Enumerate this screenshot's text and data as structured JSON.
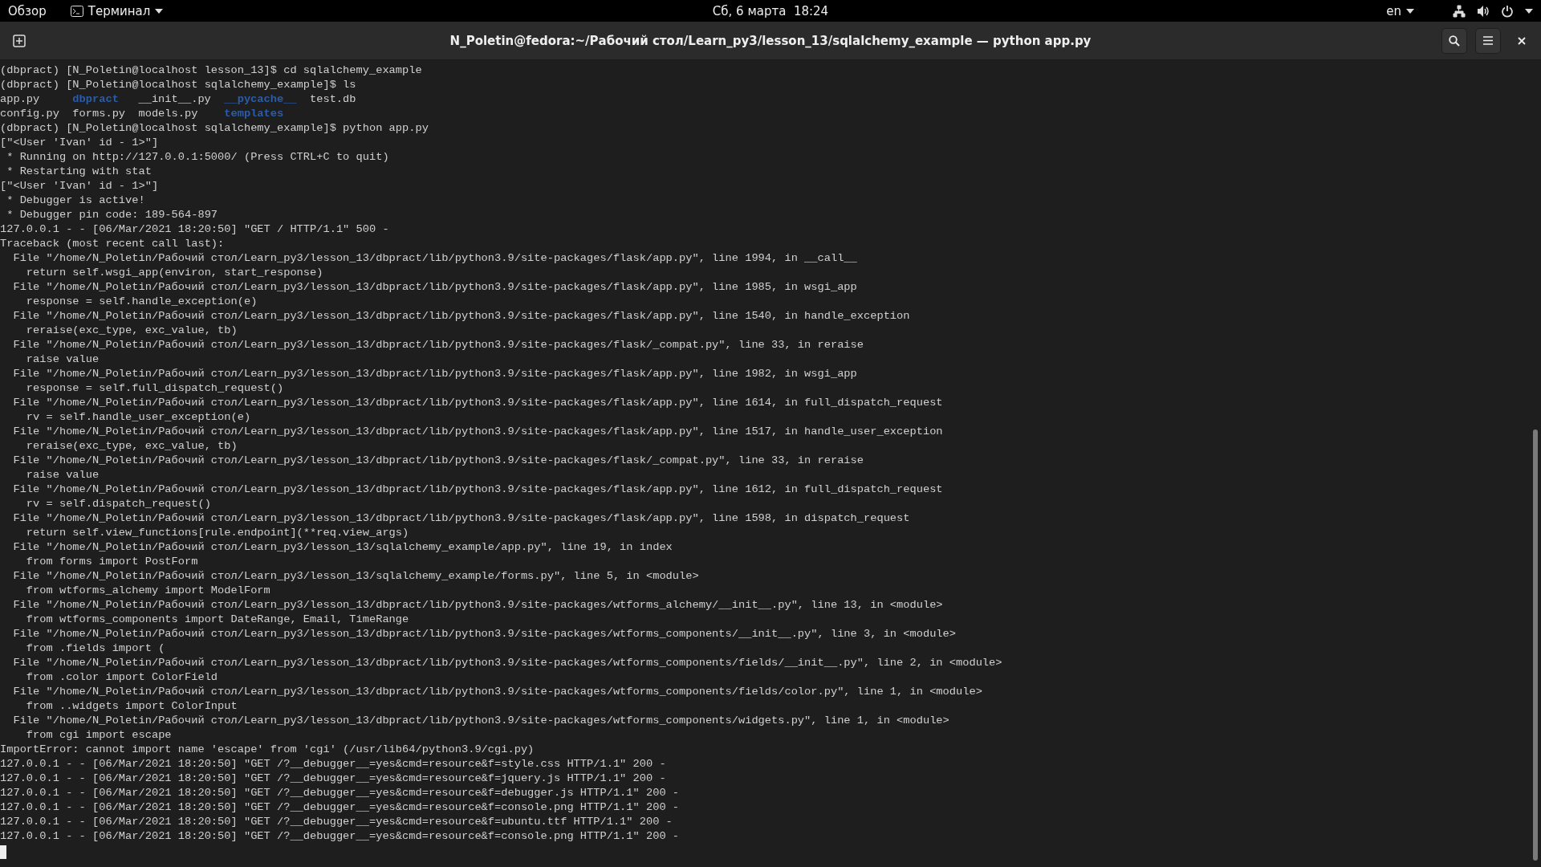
{
  "top_bar": {
    "activities": "Обзор",
    "app_menu": "Терминал",
    "clock": "Сб, 6 марта  18:24",
    "keyboard_layout": "en"
  },
  "window": {
    "title": "N_Poletin@fedora:~/Рабочий стол/Learn_py3/lesson_13/sqlalchemy_example — python app.py"
  },
  "terminal": {
    "lines": [
      {
        "kind": "text",
        "text": "(dbpract) [N_Poletin@localhost lesson_13]$ cd sqlalchemy_example"
      },
      {
        "kind": "text",
        "text": "(dbpract) [N_Poletin@localhost sqlalchemy_example]$ ls"
      },
      {
        "kind": "listing",
        "entries": [
          {
            "name": "app.py",
            "kind": "file"
          },
          {
            "name": "dbpract",
            "kind": "dir"
          },
          {
            "name": "__init__.py",
            "kind": "file"
          },
          {
            "name": "__pycache__",
            "kind": "dir"
          },
          {
            "name": "test.db",
            "kind": "file"
          }
        ]
      },
      {
        "kind": "listing",
        "entries": [
          {
            "name": "config.py",
            "kind": "file"
          },
          {
            "name": "forms.py",
            "kind": "file"
          },
          {
            "name": "models.py",
            "kind": "file"
          },
          {
            "name": "templates",
            "kind": "dir"
          }
        ]
      },
      {
        "kind": "text",
        "text": "(dbpract) [N_Poletin@localhost sqlalchemy_example]$ python app.py"
      },
      {
        "kind": "text",
        "text": "[\"<User 'Ivan' id - 1>\"]"
      },
      {
        "kind": "text",
        "text": " * Running on http://127.0.0.1:5000/ (Press CTRL+C to quit)"
      },
      {
        "kind": "text",
        "text": " * Restarting with stat"
      },
      {
        "kind": "text",
        "text": "[\"<User 'Ivan' id - 1>\"]"
      },
      {
        "kind": "text",
        "text": " * Debugger is active!"
      },
      {
        "kind": "text",
        "text": " * Debugger pin code: 189-564-897"
      },
      {
        "kind": "text",
        "text": "127.0.0.1 - - [06/Mar/2021 18:20:50] \"GET / HTTP/1.1\" 500 -"
      },
      {
        "kind": "text",
        "text": "Traceback (most recent call last):"
      },
      {
        "kind": "text",
        "text": "  File \"/home/N_Poletin/Рабочий стол/Learn_py3/lesson_13/dbpract/lib/python3.9/site-packages/flask/app.py\", line 1994, in __call__"
      },
      {
        "kind": "text",
        "text": "    return self.wsgi_app(environ, start_response)"
      },
      {
        "kind": "text",
        "text": "  File \"/home/N_Poletin/Рабочий стол/Learn_py3/lesson_13/dbpract/lib/python3.9/site-packages/flask/app.py\", line 1985, in wsgi_app"
      },
      {
        "kind": "text",
        "text": "    response = self.handle_exception(e)"
      },
      {
        "kind": "text",
        "text": "  File \"/home/N_Poletin/Рабочий стол/Learn_py3/lesson_13/dbpract/lib/python3.9/site-packages/flask/app.py\", line 1540, in handle_exception"
      },
      {
        "kind": "text",
        "text": "    reraise(exc_type, exc_value, tb)"
      },
      {
        "kind": "text",
        "text": "  File \"/home/N_Poletin/Рабочий стол/Learn_py3/lesson_13/dbpract/lib/python3.9/site-packages/flask/_compat.py\", line 33, in reraise"
      },
      {
        "kind": "text",
        "text": "    raise value"
      },
      {
        "kind": "text",
        "text": "  File \"/home/N_Poletin/Рабочий стол/Learn_py3/lesson_13/dbpract/lib/python3.9/site-packages/flask/app.py\", line 1982, in wsgi_app"
      },
      {
        "kind": "text",
        "text": "    response = self.full_dispatch_request()"
      },
      {
        "kind": "text",
        "text": "  File \"/home/N_Poletin/Рабочий стол/Learn_py3/lesson_13/dbpract/lib/python3.9/site-packages/flask/app.py\", line 1614, in full_dispatch_request"
      },
      {
        "kind": "text",
        "text": "    rv = self.handle_user_exception(e)"
      },
      {
        "kind": "text",
        "text": "  File \"/home/N_Poletin/Рабочий стол/Learn_py3/lesson_13/dbpract/lib/python3.9/site-packages/flask/app.py\", line 1517, in handle_user_exception"
      },
      {
        "kind": "text",
        "text": "    reraise(exc_type, exc_value, tb)"
      },
      {
        "kind": "text",
        "text": "  File \"/home/N_Poletin/Рабочий стол/Learn_py3/lesson_13/dbpract/lib/python3.9/site-packages/flask/_compat.py\", line 33, in reraise"
      },
      {
        "kind": "text",
        "text": "    raise value"
      },
      {
        "kind": "text",
        "text": "  File \"/home/N_Poletin/Рабочий стол/Learn_py3/lesson_13/dbpract/lib/python3.9/site-packages/flask/app.py\", line 1612, in full_dispatch_request"
      },
      {
        "kind": "text",
        "text": "    rv = self.dispatch_request()"
      },
      {
        "kind": "text",
        "text": "  File \"/home/N_Poletin/Рабочий стол/Learn_py3/lesson_13/dbpract/lib/python3.9/site-packages/flask/app.py\", line 1598, in dispatch_request"
      },
      {
        "kind": "text",
        "text": "    return self.view_functions[rule.endpoint](**req.view_args)"
      },
      {
        "kind": "text",
        "text": "  File \"/home/N_Poletin/Рабочий стол/Learn_py3/lesson_13/sqlalchemy_example/app.py\", line 19, in index"
      },
      {
        "kind": "text",
        "text": "    from forms import PostForm"
      },
      {
        "kind": "text",
        "text": "  File \"/home/N_Poletin/Рабочий стол/Learn_py3/lesson_13/sqlalchemy_example/forms.py\", line 5, in <module>"
      },
      {
        "kind": "text",
        "text": "    from wtforms_alchemy import ModelForm"
      },
      {
        "kind": "text",
        "text": "  File \"/home/N_Poletin/Рабочий стол/Learn_py3/lesson_13/dbpract/lib/python3.9/site-packages/wtforms_alchemy/__init__.py\", line 13, in <module>"
      },
      {
        "kind": "text",
        "text": "    from wtforms_components import DateRange, Email, TimeRange"
      },
      {
        "kind": "text",
        "text": "  File \"/home/N_Poletin/Рабочий стол/Learn_py3/lesson_13/dbpract/lib/python3.9/site-packages/wtforms_components/__init__.py\", line 3, in <module>"
      },
      {
        "kind": "text",
        "text": "    from .fields import ("
      },
      {
        "kind": "text",
        "text": "  File \"/home/N_Poletin/Рабочий стол/Learn_py3/lesson_13/dbpract/lib/python3.9/site-packages/wtforms_components/fields/__init__.py\", line 2, in <module>"
      },
      {
        "kind": "text",
        "text": "    from .color import ColorField"
      },
      {
        "kind": "text",
        "text": "  File \"/home/N_Poletin/Рабочий стол/Learn_py3/lesson_13/dbpract/lib/python3.9/site-packages/wtforms_components/fields/color.py\", line 1, in <module>"
      },
      {
        "kind": "text",
        "text": "    from ..widgets import ColorInput"
      },
      {
        "kind": "text",
        "text": "  File \"/home/N_Poletin/Рабочий стол/Learn_py3/lesson_13/dbpract/lib/python3.9/site-packages/wtforms_components/widgets.py\", line 1, in <module>"
      },
      {
        "kind": "text",
        "text": "    from cgi import escape"
      },
      {
        "kind": "text",
        "text": "ImportError: cannot import name 'escape' from 'cgi' (/usr/lib64/python3.9/cgi.py)"
      },
      {
        "kind": "text",
        "text": "127.0.0.1 - - [06/Mar/2021 18:20:50] \"GET /?__debugger__=yes&cmd=resource&f=style.css HTTP/1.1\" 200 -"
      },
      {
        "kind": "text",
        "text": "127.0.0.1 - - [06/Mar/2021 18:20:50] \"GET /?__debugger__=yes&cmd=resource&f=jquery.js HTTP/1.1\" 200 -"
      },
      {
        "kind": "text",
        "text": "127.0.0.1 - - [06/Mar/2021 18:20:50] \"GET /?__debugger__=yes&cmd=resource&f=debugger.js HTTP/1.1\" 200 -"
      },
      {
        "kind": "text",
        "text": "127.0.0.1 - - [06/Mar/2021 18:20:50] \"GET /?__debugger__=yes&cmd=resource&f=console.png HTTP/1.1\" 200 -"
      },
      {
        "kind": "text",
        "text": "127.0.0.1 - - [06/Mar/2021 18:20:50] \"GET /?__debugger__=yes&cmd=resource&f=ubuntu.ttf HTTP/1.1\" 200 -"
      },
      {
        "kind": "text",
        "text": "127.0.0.1 - - [06/Mar/2021 18:20:50] \"GET /?__debugger__=yes&cmd=resource&f=console.png HTTP/1.1\" 200 -"
      }
    ]
  }
}
